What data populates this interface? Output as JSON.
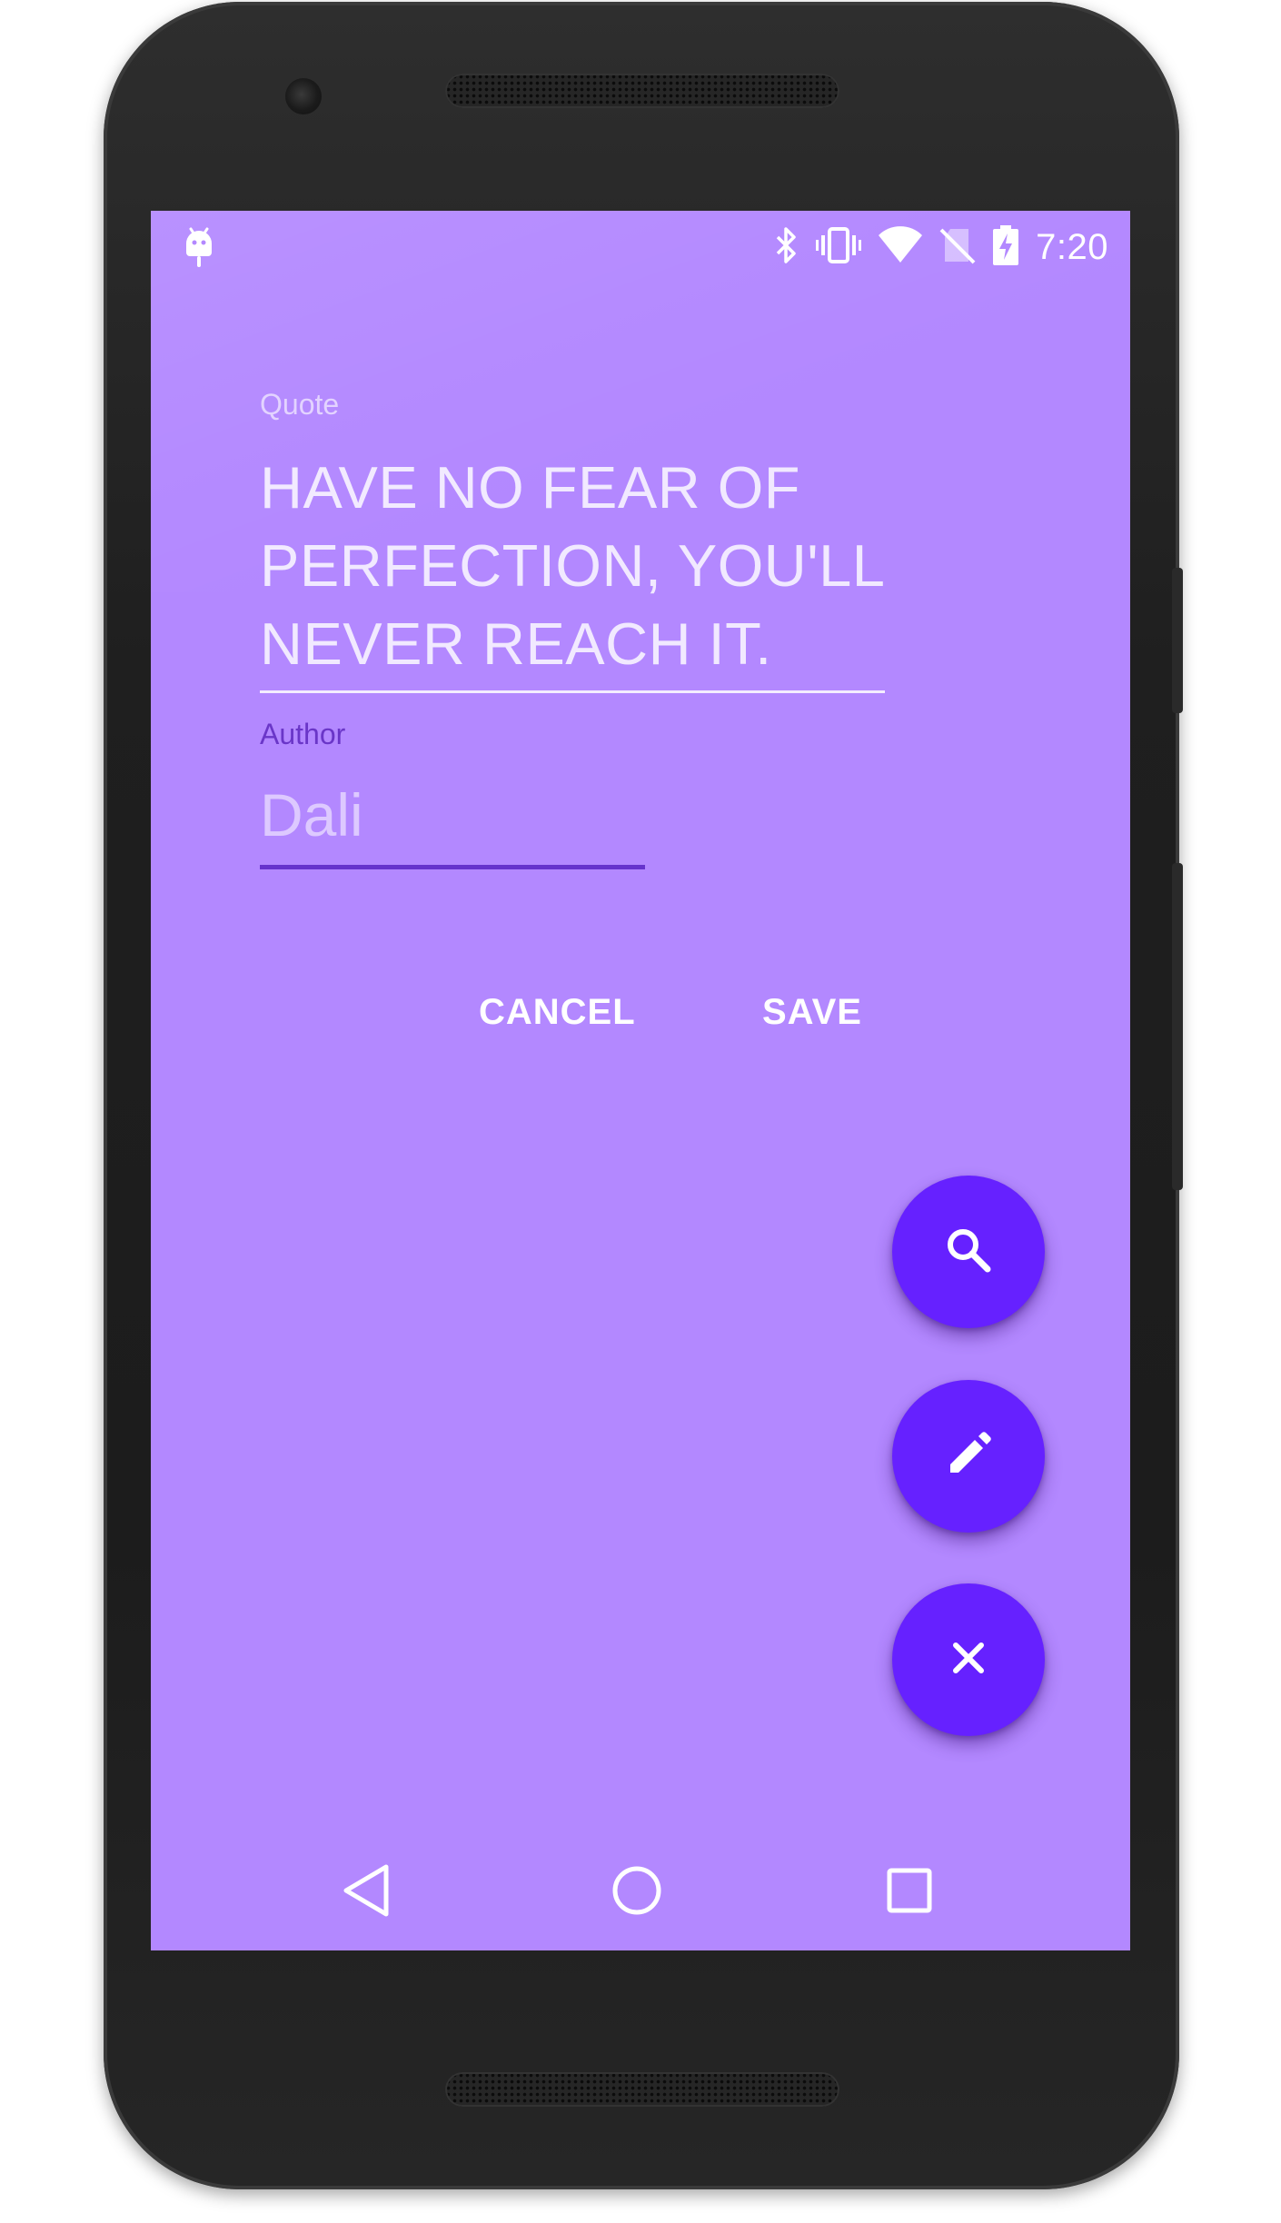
{
  "status_bar": {
    "time": "7:20",
    "icons": [
      "android-debug-icon",
      "bluetooth-icon",
      "vibrate-icon",
      "wifi-icon",
      "no-sim-icon",
      "battery-charging-icon"
    ]
  },
  "form": {
    "quote_label": "Quote",
    "quote_text": "HAVE NO FEAR OF\nPERFECTION, YOU'LL\nNEVER REACH IT.",
    "author_label": "Author",
    "author_value": "Dali"
  },
  "actions": {
    "cancel_label": "CANCEL",
    "save_label": "SAVE"
  },
  "fabs": [
    "search-icon",
    "edit-icon",
    "close-icon"
  ],
  "nav_bar": [
    "back-icon",
    "home-icon",
    "recents-icon"
  ],
  "colors": {
    "background": "#b388ff",
    "accent": "#6621ff",
    "author_label": "#6a36c8",
    "author_underline": "#6633cc"
  }
}
